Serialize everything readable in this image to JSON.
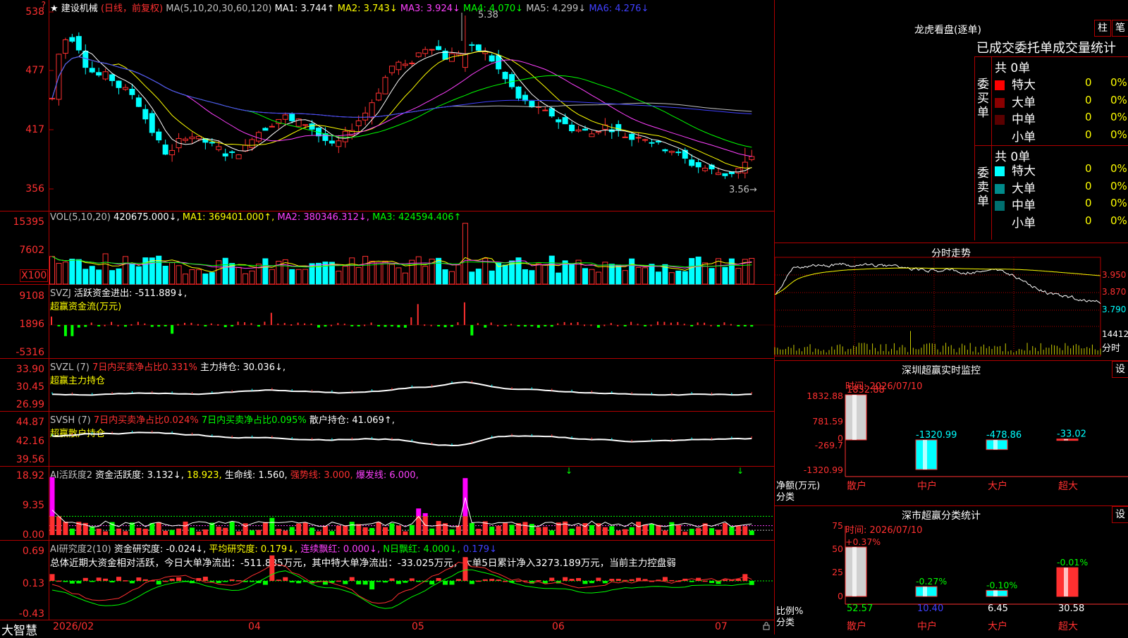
{
  "header": {
    "star": "★",
    "stock_name": "建设机械",
    "period": "(日线，前复权)",
    "ma_label": "MA(5,10,20,30,60,120)",
    "ma1": "MA1: 3.744↑",
    "ma2": "MA2: 3.743↓",
    "ma3": "MA3: 3.924↓",
    "ma4": "MA4: 4.070↓",
    "ma5": "MA5: 4.299↓",
    "ma6": "MA6: 4.276↓",
    "high_marker": "5.38",
    "low_marker": "3.56→",
    "corner_mark": "?"
  },
  "price_axis": [
    "538",
    "477",
    "417",
    "356"
  ],
  "vol": {
    "label": "VOL(5,10,20)",
    "value": "420675.000↓,",
    "ma1": "MA1: 369401.000↑,",
    "ma2": "MA2: 380346.312↓,",
    "ma3": "MA3: 424594.406↑",
    "axis": [
      "15395",
      "7602"
    ],
    "unit": "X100"
  },
  "svzj": {
    "label": "SVZJ",
    "text": "活跃资金进出: -511.889↓,",
    "title": "超赢资金流(万元)",
    "axis": [
      "9108",
      "1896",
      "-5316"
    ]
  },
  "svzl": {
    "label": "SVZL (7)",
    "text1": "7日内买卖净占比0.331%",
    "text2": "主力持仓: 30.036↓,",
    "title": "超赢主力持仓",
    "axis": [
      "33.90",
      "30.45",
      "26.99"
    ]
  },
  "svsh": {
    "label": "SVSH (7)",
    "text1": "7日内买卖净占比0.024%",
    "text2": "7日内买卖净占比0.095%",
    "text3": "散户持仓: 41.069↑,",
    "title": "超赢散户持仓",
    "axis": [
      "44.87",
      "42.16",
      "39.56"
    ]
  },
  "ai1": {
    "label": "AI活跃度2",
    "t1": "资金活跃度: 3.132↓,",
    "t2": "18.923,",
    "t3": "生命线: 1.560,",
    "t4": "强势线: 3.000,",
    "t5": "爆发线: 6.000,",
    "axis": [
      "18.92",
      "9.35",
      "0.00"
    ]
  },
  "ai2": {
    "label": "AI研究度2(10)",
    "t1": "资金研究度: -0.024↓,",
    "t2": "平均研究度: 0.179↓,",
    "t3": "连续飘红: 0.000↓,",
    "t4": "N日飘红: 4.000↓,",
    "t5": "0.179↓",
    "summary": "总体近期大资金相对活跃，今日大单净流出：-511.885万元，其中特大单净流出：-33.025万元，大单5日累计净入3273.189万元，当前主力控盘弱",
    "axis": [
      "0.69",
      "0.13",
      "-0.43"
    ]
  },
  "footer": {
    "brand": "大智慧",
    "dates": [
      "2026/02",
      "04",
      "05",
      "06",
      "07"
    ]
  },
  "lhb": {
    "title": "龙虎看盘(逐单)",
    "btn1": "柱",
    "btn2": "笔",
    "subtitle": "已成交委托单成交量统计",
    "buy_side": "委买单",
    "sell_side": "委卖单",
    "buy_total": "共 0单",
    "sell_total": "共 0单",
    "buy_rows": [
      {
        "label": "特大",
        "count": "0",
        "pct": "0%",
        "color": "#ff0000"
      },
      {
        "label": "大单",
        "count": "0",
        "pct": "0%",
        "color": "#8b0000"
      },
      {
        "label": "中单",
        "count": "0",
        "pct": "0%",
        "color": "#5a0000"
      },
      {
        "label": "小单",
        "count": "0",
        "pct": "0%",
        "color": ""
      }
    ],
    "sell_rows": [
      {
        "label": "特大",
        "count": "0",
        "pct": "0%",
        "color": "#00ffff"
      },
      {
        "label": "大单",
        "count": "0",
        "pct": "0%",
        "color": "#008b8b"
      },
      {
        "label": "中单",
        "count": "0",
        "pct": "0%",
        "color": "#006f6f"
      },
      {
        "label": "小单",
        "count": "0",
        "pct": "0%",
        "color": ""
      }
    ]
  },
  "intraday": {
    "title": "分时走势",
    "prices": [
      "3.950",
      "3.870",
      "3.790"
    ],
    "vol": "14412",
    "vol_label": "分时"
  },
  "sz_monitor": {
    "title": "深圳超赢实时监控",
    "btn": "设",
    "date": "时间: 2026/07/10",
    "axis": [
      "1832.88",
      "781.59",
      "0",
      "-269.7",
      "-1320.99"
    ],
    "y_label": "净额(万元)",
    "x_label": "分类",
    "labels": [
      "散户",
      "中户",
      "大户",
      "超大"
    ],
    "values": [
      1832.88,
      -1320.99,
      -478.86,
      -33.02
    ],
    "value_texts": [
      "1832.88",
      "-1320.99",
      "-478.86",
      "-33.02"
    ]
  },
  "sz_stats": {
    "title": "深市超赢分类统计",
    "btn": "设",
    "date": "时间: 2026/07/10",
    "axis": [
      "75",
      "50",
      "25",
      "0"
    ],
    "y_label": "比例%",
    "x_label": "分类",
    "labels": [
      "散户",
      "中户",
      "大户",
      "超大"
    ],
    "values": [
      52.57,
      10.4,
      6.45,
      30.58
    ],
    "value_texts": [
      "52.57",
      "10.40",
      "6.45",
      "30.58"
    ],
    "changes": [
      "+0.37%",
      "-0.27%",
      "-0.10%",
      "-0.01%"
    ]
  },
  "colors": {
    "up": "#ff3030",
    "down": "#00ffff",
    "grid": "#b00000",
    "ma1": "#ffffff",
    "ma2": "#ffff00",
    "ma3": "#ff40ff",
    "ma4": "#00ff00",
    "ma5": "#c0c0c0",
    "ma6": "#4040ff"
  }
}
